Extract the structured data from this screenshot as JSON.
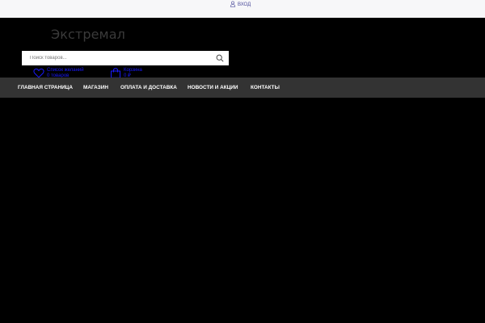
{
  "topbar": {
    "login_label": "Вход",
    "login_icon": "user-icon"
  },
  "header": {
    "logo_text": "Экстремал",
    "search": {
      "placeholder": "Поиск товаров...",
      "icon": "search-icon"
    },
    "wishlist": {
      "icon": "heart-icon",
      "line1": "Список желаний",
      "line2": "0 товаров"
    },
    "cart": {
      "icon": "shopping-bag-icon",
      "line1": "Корзина",
      "line2": "0 ₽"
    }
  },
  "nav": {
    "items": [
      {
        "label": "Главная страница"
      },
      {
        "label": "Магазин"
      },
      {
        "label": "Оплата и доставка"
      },
      {
        "label": "Новости и акции"
      },
      {
        "label": "Контакты"
      }
    ]
  },
  "colors": {
    "page_bg": "#000000",
    "topbar_bg": "#f7f7f9",
    "nav_bg": "#333333",
    "accent_link": "#1a1aff",
    "login_text": "#4b4b9a"
  }
}
